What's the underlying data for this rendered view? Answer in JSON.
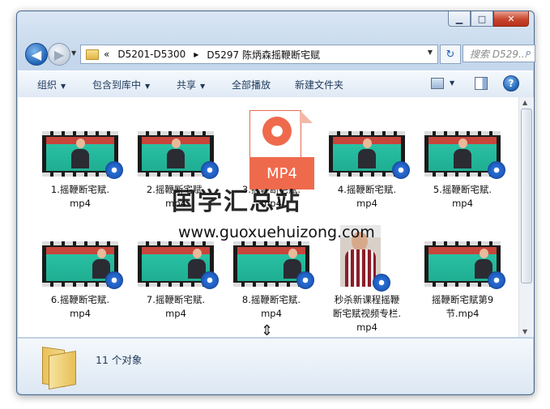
{
  "window": {
    "address": {
      "overflow_glyph": "«",
      "segments": [
        "D5201-D5300",
        "D5297 陈炳森摇鞭断宅赋"
      ],
      "separator": "▶"
    },
    "search_placeholder": "搜索 D529...",
    "caption_buttons": {
      "minimize": "▁",
      "maximize": "□",
      "close": "✕"
    }
  },
  "toolbar": {
    "organize": "组织",
    "include_in_library": "包含到库中",
    "share": "共享",
    "play_all": "全部播放",
    "new_folder": "新建文件夹"
  },
  "files": [
    {
      "name": "1.摇鞭断宅赋.mp4",
      "line1": "1.摇鞭断宅赋.",
      "line2": "mp4",
      "thumb": "video"
    },
    {
      "name": "2.摇鞭断宅赋.mp4",
      "line1": "2.摇鞭断宅赋.",
      "line2": "mp4",
      "thumb": "video"
    },
    {
      "name": "3.摇鞭断宅赋.mp4",
      "line1": "3.摇鞭断宅赋.",
      "line2": "mp4",
      "thumb": "mp4-doc",
      "doc_label": "MP4"
    },
    {
      "name": "4.摇鞭断宅赋.mp4",
      "line1": "4.摇鞭断宅赋.",
      "line2": "mp4",
      "thumb": "video"
    },
    {
      "name": "5.摇鞭断宅赋.mp4",
      "line1": "5.摇鞭断宅赋.",
      "line2": "mp4",
      "thumb": "video"
    },
    {
      "name": "6.摇鞭断宅赋.mp4",
      "line1": "6.摇鞭断宅赋.",
      "line2": "mp4",
      "thumb": "video"
    },
    {
      "name": "7.摇鞭断宅赋.mp4",
      "line1": "7.摇鞭断宅赋.",
      "line2": "mp4",
      "thumb": "video"
    },
    {
      "name": "8.摇鞭断宅赋.mp4",
      "line1": "8.摇鞭断宅赋.",
      "line2": "mp4",
      "thumb": "video"
    },
    {
      "name": "秒杀新课程摇鞭断宅赋视频专栏.mp4",
      "line1": "秒杀新课程摇鞭",
      "line2": "断宅赋视频专栏.",
      "line3": "mp4",
      "thumb": "portrait"
    },
    {
      "name": "摇鞭断宅赋第9节.mp4",
      "line1": "摇鞭断宅赋第9",
      "line2": "节.mp4",
      "thumb": "video"
    }
  ],
  "watermark": {
    "cn": "国学汇总站",
    "url": "www.guoxuehuizong.com"
  },
  "details": {
    "count": "11 个对象"
  },
  "colors": {
    "accent": "#1f62b5",
    "toolbar_text": "#1e395b",
    "mp4_orange": "#ef6a4c",
    "board_green": "#29c0a3"
  }
}
